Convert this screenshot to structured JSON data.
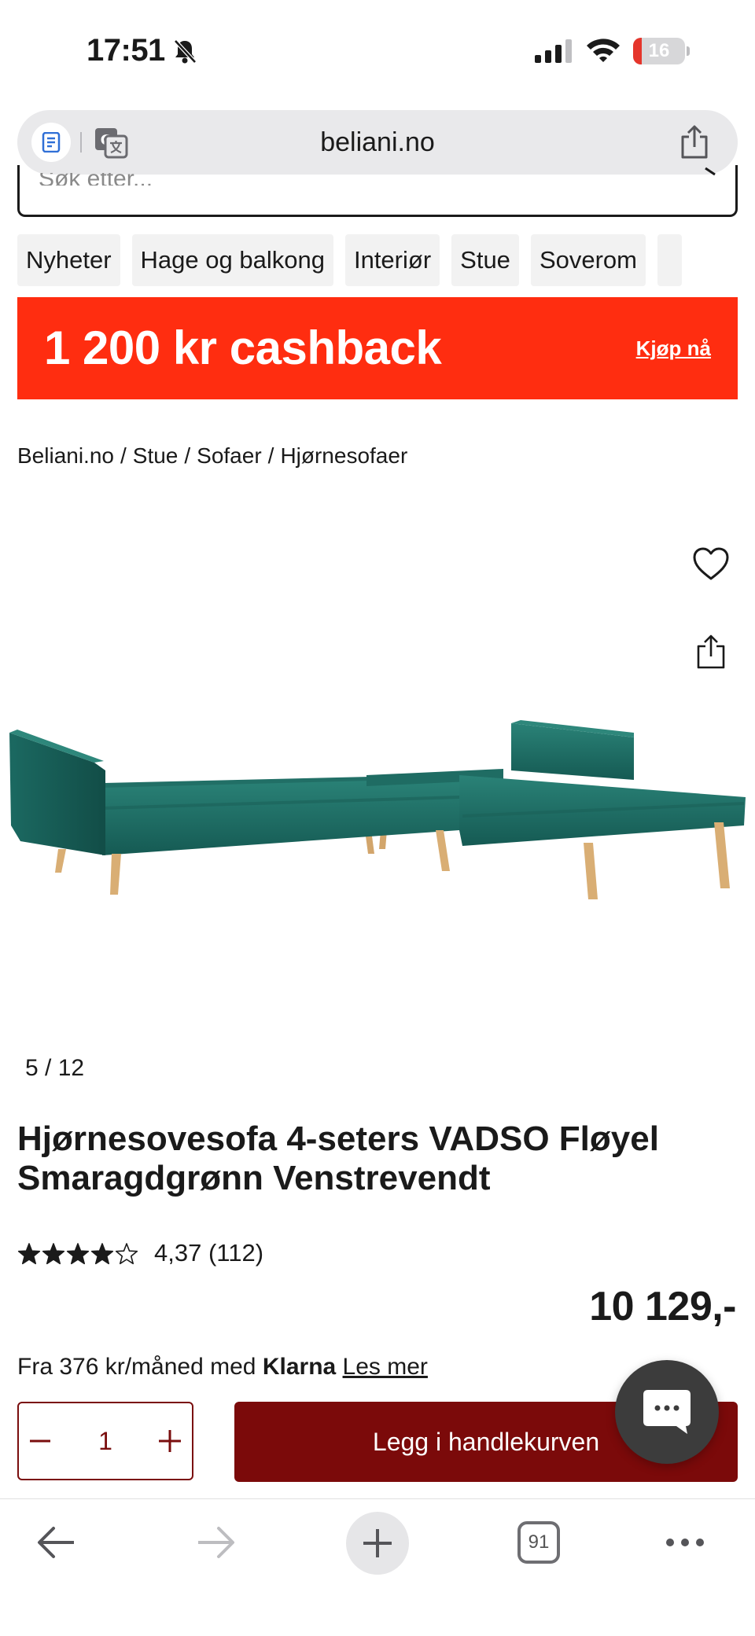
{
  "status_bar": {
    "time": "17:51",
    "battery_level": "16",
    "battery_fraction": 0.16,
    "icons": [
      "bell-slash-icon",
      "signal-icon",
      "wifi-icon",
      "battery-icon"
    ]
  },
  "browser": {
    "url": "beliani.no",
    "icons": [
      "reader-icon",
      "translate-icon",
      "share-icon"
    ]
  },
  "search": {
    "placeholder_fragment": "Søk etter..."
  },
  "categories": [
    "Nyheter",
    "Hage og balkong",
    "Interiør",
    "Stue",
    "Soverom"
  ],
  "banner": {
    "text": "1 200 kr cashback",
    "link": "Kjøp nå",
    "color": "#ff2d10"
  },
  "breadcrumb": [
    "Beliani.no",
    "Stue",
    "Sofaer",
    "Hjørnesofaer"
  ],
  "breadcrumb_separator": "/",
  "gallery": {
    "counter": "5 / 12",
    "product_color": "#1e6f66"
  },
  "product": {
    "title": "Hjørnesovesofa 4-seters VADSO Fløyel Smaragdgrønn Venstrevendt",
    "rating": 4.37,
    "rating_max": 5,
    "rating_text": "4,37 (112)",
    "price": "10 129,-",
    "financing": {
      "prefix": "Fra 376 kr/måned med",
      "brand": "Klarna",
      "link": "Les mer"
    }
  },
  "cart": {
    "quantity": "1",
    "add_button": "Legg i handlekurven",
    "accent_color": "#7b0a0a"
  },
  "toolbar": {
    "tabs_count": "91",
    "icons": [
      "back-arrow-icon",
      "forward-arrow-icon",
      "plus-icon",
      "tabs-icon",
      "more-icon"
    ]
  }
}
